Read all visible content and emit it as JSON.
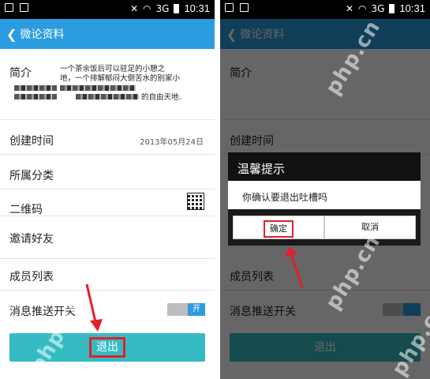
{
  "status_bar": {
    "time": "10:31",
    "signal_label": "3G"
  },
  "header": {
    "back_glyph": "❮",
    "title": "微论资料"
  },
  "profile": {
    "intro_label": "简介",
    "intro_lines": [
      "一个茶余饭后可以驻足的小憩之",
      "地，一个排解郁闷大倒苦水的别家小",
      "的自由天地."
    ],
    "created_label": "创建时间",
    "created_value": "2013年05月24日",
    "category_label": "所属分类",
    "qrcode_label": "二维码",
    "invite_label": "邀请好友",
    "members_label": "成员列表",
    "push_label": "消息推送开关",
    "push_toggle_text": "开",
    "push_on": true,
    "logout_label": "退出"
  },
  "dialog": {
    "title": "温馨提示",
    "message": "你确认要退出吐槽吗",
    "confirm_label": "确定",
    "cancel_label": "取消"
  },
  "watermark_text": "php.cn",
  "colors": {
    "header": "#2b9cdf",
    "logout_button": "#35bcc3",
    "highlight": "#e0202a"
  }
}
